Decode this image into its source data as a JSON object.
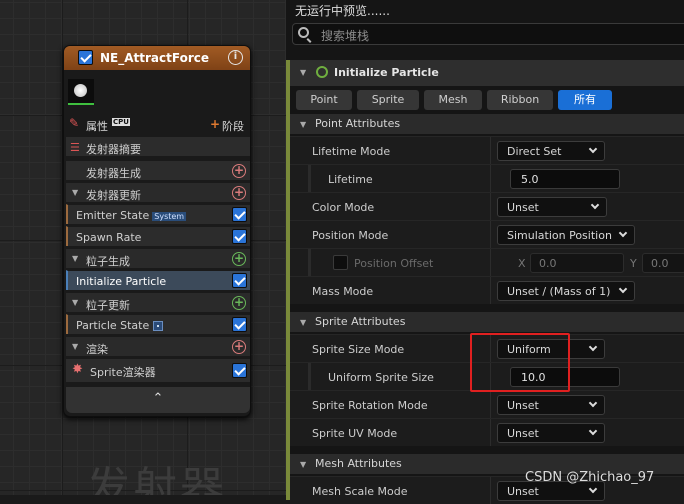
{
  "graph": {
    "background_text": "发射器"
  },
  "node": {
    "title": "NE_AttractForce",
    "props_label": "属性",
    "cpu_badge": "CPU",
    "stage_label": "阶段",
    "rows": {
      "emitter_summary": "发射器摘要",
      "emitter_spawn": "发射器生成",
      "emitter_update": "发射器更新",
      "emitter_state": "Emitter State",
      "emitter_state_badge": "System",
      "spawn_rate": "Spawn Rate",
      "particle_spawn": "粒子生成",
      "initialize_particle": "Initialize Particle",
      "particle_update": "粒子更新",
      "particle_state": "Particle State",
      "render": "渲染",
      "sprite_renderer": "Sprite渲染器"
    }
  },
  "panel": {
    "status": "无运行中预览......",
    "search_placeholder": "搜索堆栈",
    "module_title": "Initialize Particle",
    "filters": [
      "Point",
      "Sprite",
      "Mesh",
      "Ribbon",
      "所有"
    ],
    "active_filter": "所有",
    "point_attributes": "Point Attributes",
    "lifetime_mode": {
      "label": "Lifetime Mode",
      "value": "Direct Set"
    },
    "lifetime": {
      "label": "Lifetime",
      "value": "5.0"
    },
    "color_mode": {
      "label": "Color Mode",
      "value": "Unset"
    },
    "position_mode": {
      "label": "Position Mode",
      "value": "Simulation Position"
    },
    "position_offset": {
      "label": "Position Offset",
      "x_label": "X",
      "x": "0.0",
      "y_label": "Y",
      "y": "0.0"
    },
    "mass_mode": {
      "label": "Mass Mode",
      "value": "Unset / (Mass of 1)"
    },
    "sprite_attributes": "Sprite Attributes",
    "sprite_size_mode": {
      "label": "Sprite Size Mode",
      "value": "Uniform"
    },
    "uniform_sprite_size": {
      "label": "Uniform Sprite Size",
      "value": "10.0"
    },
    "sprite_rotation_mode": {
      "label": "Sprite Rotation Mode",
      "value": "Unset"
    },
    "sprite_uv_mode": {
      "label": "Sprite UV Mode",
      "value": "Unset"
    },
    "mesh_attributes": "Mesh Attributes",
    "mesh_scale_mode": {
      "label": "Mesh Scale Mode",
      "value": "Unset"
    }
  },
  "watermark": "CSDN @Zhichao_97",
  "colors": {
    "accent": "#1a6fd6",
    "node_header": "#a15b24",
    "highlight": "#e02020",
    "stack_bar": "#7a8a3a"
  }
}
